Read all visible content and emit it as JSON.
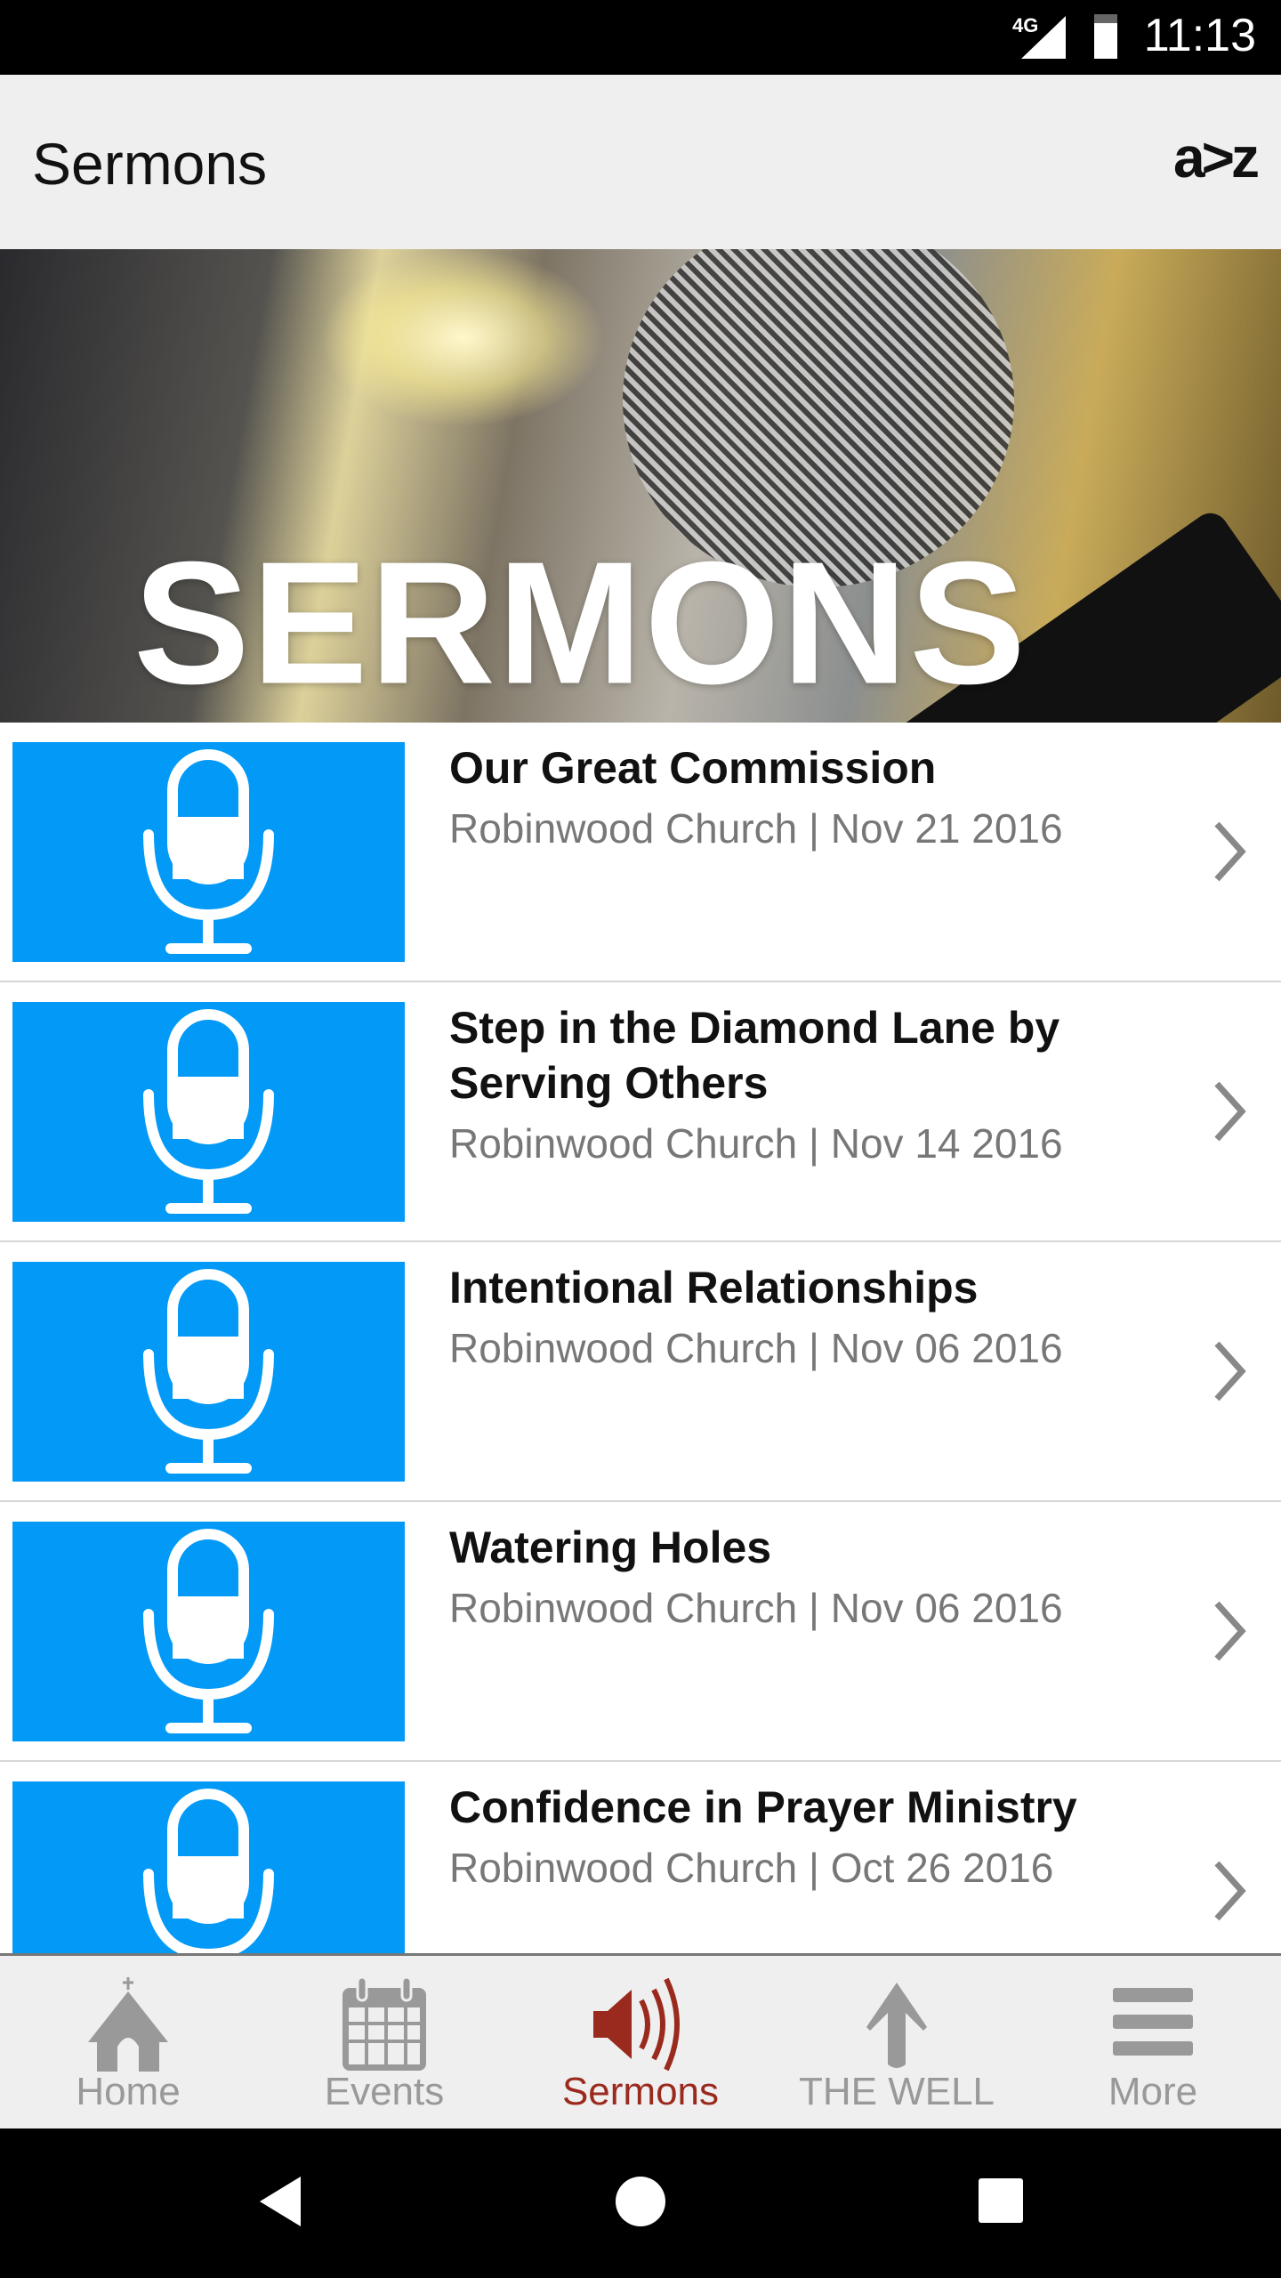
{
  "status_bar": {
    "network": "4G",
    "time": "11:13"
  },
  "app_bar": {
    "title": "Sermons",
    "sort_label": "a>z"
  },
  "banner": {
    "text": "SERMONS"
  },
  "sermons": [
    {
      "title": "Our Great Commission",
      "subtitle": "Robinwood Church | Nov 21 2016"
    },
    {
      "title": "Step in the Diamond Lane by Serving Others",
      "subtitle": "Robinwood Church | Nov 14 2016"
    },
    {
      "title": "Intentional Relationships",
      "subtitle": "Robinwood Church | Nov 06 2016"
    },
    {
      "title": "Watering Holes",
      "subtitle": "Robinwood Church | Nov 06 2016"
    },
    {
      "title": "Confidence in Prayer Ministry",
      "subtitle": "Robinwood Church | Oct 26 2016"
    }
  ],
  "tabs": [
    {
      "label": "Home",
      "icon": "church-icon"
    },
    {
      "label": "Events",
      "icon": "calendar-icon"
    },
    {
      "label": "Sermons",
      "icon": "speaker-icon",
      "active": true
    },
    {
      "label": "THE WELL",
      "icon": "arrow-up-icon"
    },
    {
      "label": "More",
      "icon": "menu-icon"
    }
  ],
  "colors": {
    "accent": "#9a2a1d",
    "thumb": "#0399f7",
    "inactive": "#999999"
  }
}
